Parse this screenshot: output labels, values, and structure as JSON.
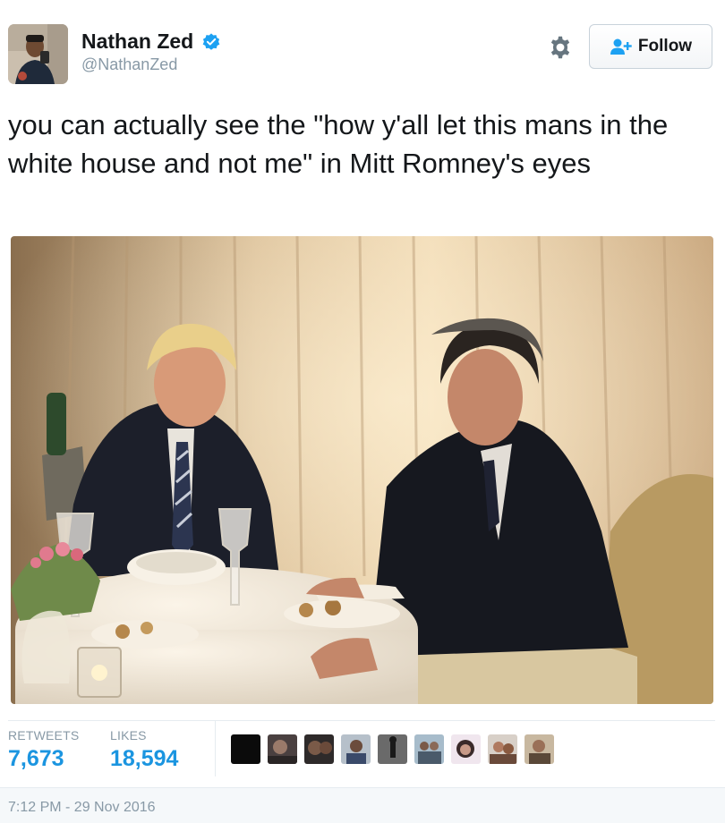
{
  "user": {
    "display_name": "Nathan Zed",
    "handle": "@NathanZed",
    "verified": true
  },
  "actions": {
    "follow_label": "Follow"
  },
  "tweet": {
    "text": "you can actually see the \"how y'all let this mans in the white house and not me\" in Mitt Romney's eyes"
  },
  "stats": {
    "retweets_label": "RETWEETS",
    "retweets_count": "7,673",
    "likes_label": "LIKES",
    "likes_count": "18,594"
  },
  "timestamp": "7:12 PM - 29 Nov 2016",
  "colors": {
    "accent": "#1b95e0",
    "muted": "#8899a6",
    "text": "#14171a",
    "border": "#e6ecf0"
  },
  "icons": {
    "settings": "gear-icon",
    "follow": "add-user-icon",
    "verified": "verified-badge-icon"
  },
  "liker_avatar_count": 10
}
